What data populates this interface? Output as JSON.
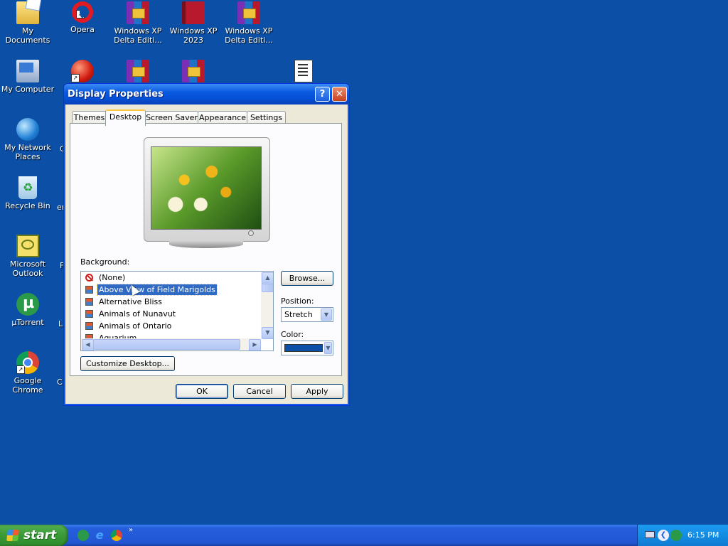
{
  "desktop": {
    "icons": [
      {
        "label": "My Documents",
        "icon": "my-documents-icon"
      },
      {
        "label": "Opera",
        "icon": "opera-icon"
      },
      {
        "label": "Windows XP\nDelta Editi...",
        "icon": "winrar-archive-icon"
      },
      {
        "label": "Windows XP\n2023",
        "icon": "book-icon"
      },
      {
        "label": "Windows XP\nDelta Editi...",
        "icon": "winrar-archive-icon"
      },
      {
        "label": "My Computer",
        "icon": "my-computer-icon"
      },
      {
        "label": "My Network\nPlaces",
        "icon": "network-places-icon"
      },
      {
        "label": "Recycle Bin",
        "icon": "recycle-bin-icon"
      },
      {
        "label": "Microsoft\nOutlook",
        "icon": "outlook-icon"
      },
      {
        "label": "µTorrent",
        "icon": "utorrent-icon"
      },
      {
        "label": "Google Chrome",
        "icon": "chrome-icon"
      }
    ],
    "partial_labels": [
      "C",
      "er",
      "F",
      "L",
      "C"
    ]
  },
  "dialog": {
    "title": "Display Properties",
    "tabs": [
      "Themes",
      "Desktop",
      "Screen Saver",
      "Appearance",
      "Settings"
    ],
    "active_tab": "Desktop",
    "background_label": "Background:",
    "backgrounds": [
      "(None)",
      "Above View of Field Marigolds",
      "Alternative Bliss",
      "Animals of Nunavut",
      "Animals of Ontario",
      "Aquarium"
    ],
    "selected_background": "Above View of Field Marigolds",
    "browse_label": "Browse...",
    "position_label": "Position:",
    "position_value": "Stretch",
    "color_label": "Color:",
    "color_value": "#0b4fa6",
    "customize_label": "Customize Desktop...",
    "ok_label": "OK",
    "cancel_label": "Cancel",
    "apply_label": "Apply"
  },
  "taskbar": {
    "start_label": "start",
    "clock": "6:15 PM"
  },
  "colors": {
    "desktop_background": "#0b4fa6",
    "title_bar": "#0550d6",
    "selection": "#316ac5"
  }
}
